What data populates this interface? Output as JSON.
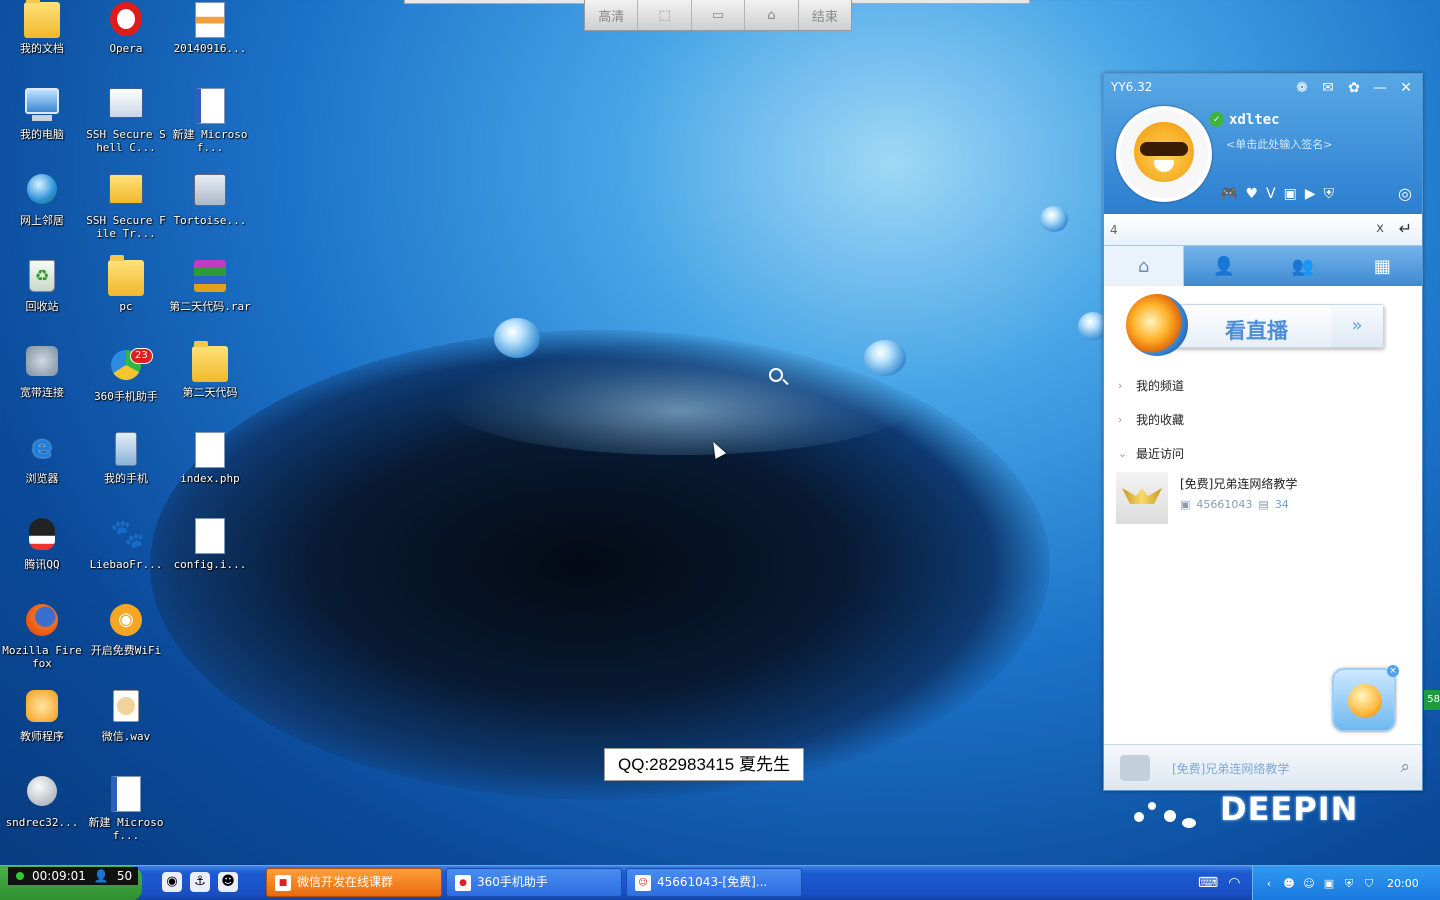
{
  "desktop": {
    "icons_col1": [
      {
        "label": "我的文档",
        "icon": "my-documents-icon"
      },
      {
        "label": "我的电脑",
        "icon": "my-computer-icon"
      },
      {
        "label": "网上邻居",
        "icon": "network-icon"
      },
      {
        "label": "回收站",
        "icon": "recycle-bin-icon"
      },
      {
        "label": "宽带连接",
        "icon": "broadband-icon"
      },
      {
        "label": "浏览器",
        "icon": "ie-icon"
      },
      {
        "label": "腾讯QQ",
        "icon": "qq-icon"
      },
      {
        "label": "Mozilla Firefox",
        "icon": "firefox-icon"
      },
      {
        "label": "教师程序",
        "icon": "teacher-app-icon"
      },
      {
        "label": "sndrec32...",
        "icon": "sound-recorder-icon"
      }
    ],
    "icons_col2": [
      {
        "label": "Opera",
        "icon": "opera-icon"
      },
      {
        "label": "SSH Secure Shell C...",
        "icon": "ssh-shell-icon"
      },
      {
        "label": "SSH Secure File Tr...",
        "icon": "ssh-file-icon"
      },
      {
        "label": "pc",
        "icon": "folder-icon"
      },
      {
        "label": "360手机助手",
        "icon": "360-phone-icon",
        "badge": "23"
      },
      {
        "label": "我的手机",
        "icon": "my-phone-icon"
      },
      {
        "label": "LiebaoFr...",
        "icon": "liebao-icon"
      },
      {
        "label": "开启免费WiFi",
        "icon": "free-wifi-icon"
      },
      {
        "label": "微信.wav",
        "icon": "wav-file-icon"
      },
      {
        "label": "新建 Microsof...",
        "icon": "word-doc-icon"
      }
    ],
    "icons_col3": [
      {
        "label": "20140916...",
        "icon": "archive-file-icon"
      },
      {
        "label": "新建 Microsof...",
        "icon": "word-doc-icon"
      },
      {
        "label": "Tortoise...",
        "icon": "tortoise-icon"
      },
      {
        "label": "第二天代码.rar",
        "icon": "rar-icon"
      },
      {
        "label": "第二天代码",
        "icon": "folder-icon"
      },
      {
        "label": "index.php",
        "icon": "php-file-icon"
      },
      {
        "label": "config.i...",
        "icon": "config-file-icon"
      }
    ],
    "watermark": "QQ:282983415 夏先生",
    "brand": "DEEPIN"
  },
  "recorder_toolbar": {
    "buttons": [
      "高清",
      "",
      "",
      "",
      "结束"
    ]
  },
  "yy": {
    "title": "YY6.32",
    "nickname": "xdltec",
    "signature": "<单击此处输入签名>",
    "search_value": "4",
    "tabs": [
      "home-tab-icon",
      "contact-tab-icon",
      "group-tab-icon",
      "apps-tab-icon"
    ],
    "live_label": "看直播",
    "tree": [
      {
        "label": "我的频道",
        "expanded": false
      },
      {
        "label": "我的收藏",
        "expanded": false
      },
      {
        "label": "最近访问",
        "expanded": true
      }
    ],
    "recent": {
      "title": "[免费]兄弟连网络教学",
      "channel_id": "45661043",
      "online": "34"
    },
    "footer_channel": "[免费]兄弟连网络教学",
    "side_badge": "58"
  },
  "taskbar": {
    "timer": "00:09:01",
    "viewers": "50",
    "tasks": [
      {
        "label": "微信开发在线课群",
        "active": true
      },
      {
        "label": "360手机助手",
        "active": false
      },
      {
        "label": "45661043-[免费]...",
        "active": false
      }
    ],
    "clock": "20:00"
  }
}
